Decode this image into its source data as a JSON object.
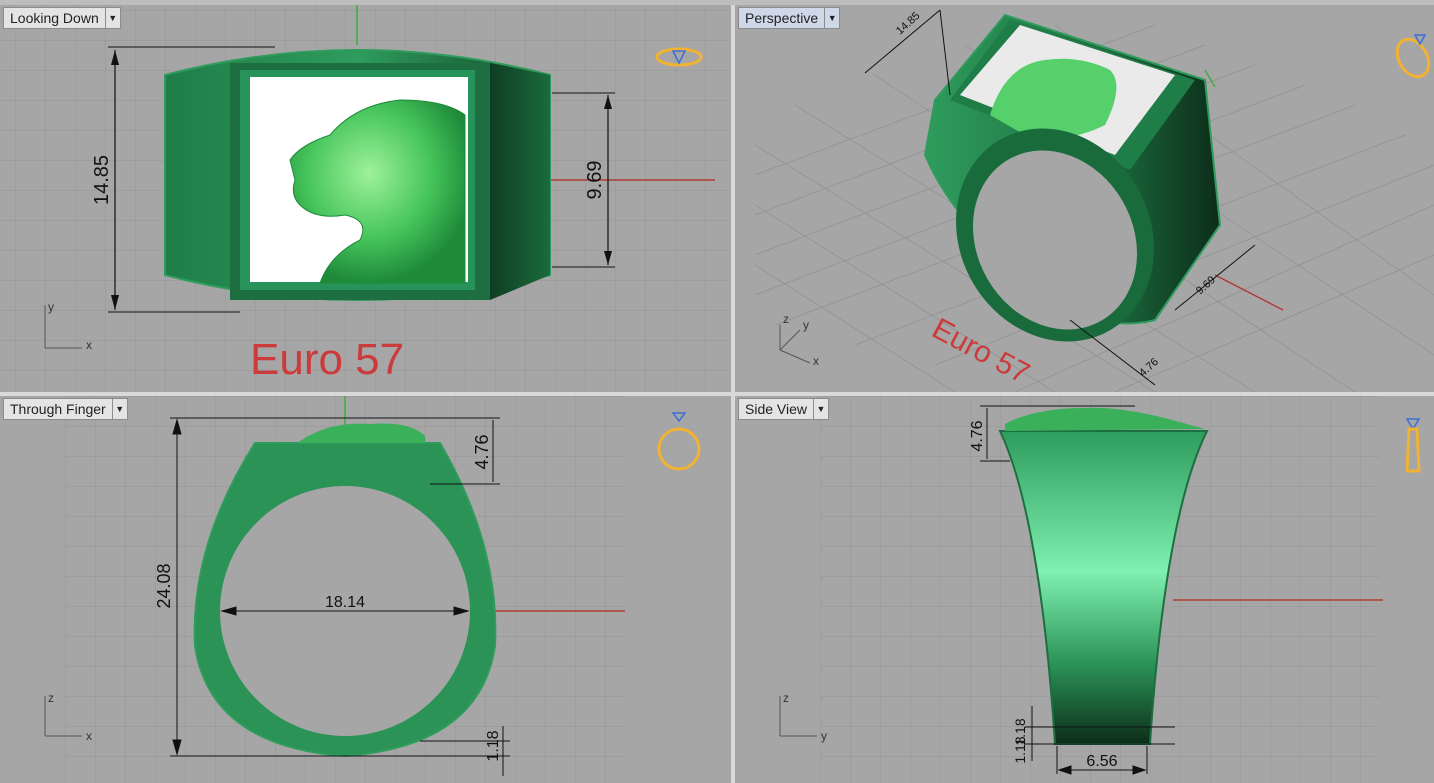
{
  "viewports": {
    "looking_down": {
      "title": "Looking Down",
      "text_label": "Euro 57",
      "dims": {
        "height": "14.85",
        "inner": "9.69"
      },
      "axes": {
        "v": "y",
        "h": "x"
      }
    },
    "perspective": {
      "title": "Perspective",
      "text_label": "Euro 57",
      "dims": {
        "a": "14.85",
        "b": "9.69",
        "c": "4.76"
      },
      "axes": {
        "z": "z",
        "y": "y",
        "x": "x"
      }
    },
    "through_finger": {
      "title": "Through Finger",
      "dims": {
        "total": "24.08",
        "top": "4.76",
        "inner": "18.14",
        "bottom": "1.18"
      },
      "axes": {
        "v": "z",
        "h": "x"
      }
    },
    "side_view": {
      "title": "Side View",
      "dims": {
        "top": "4.76",
        "bottom_a": "1.18",
        "bottom_b": "1.18",
        "width": "6.56"
      },
      "axes": {
        "v": "z",
        "h": "y"
      }
    }
  },
  "colors": {
    "ring_green": "#2e9c5c",
    "dim_line": "#111111",
    "axis_red": "#b23b33",
    "axis_green": "#3fae3f",
    "icon_orange": "#f2b233"
  },
  "icons": [
    "ring-top-icon",
    "ring-perspective-icon",
    "ring-front-icon",
    "ring-side-icon",
    "dropdown-icon"
  ]
}
